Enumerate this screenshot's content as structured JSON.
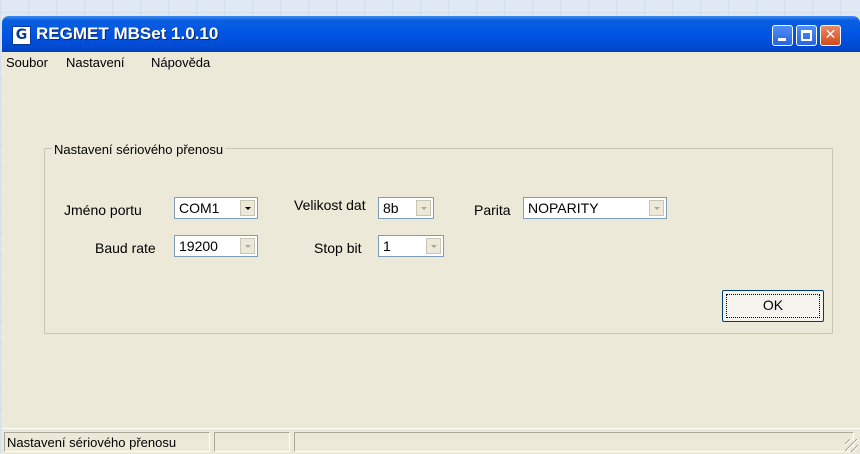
{
  "window": {
    "app_icon": "G",
    "title": "REGMET MBSet 1.0.10"
  },
  "title_buttons": {
    "minimize_icon": "minimize-icon",
    "maximize_icon": "maximize-icon",
    "close_icon": "close-icon",
    "close_glyph": "✕"
  },
  "menu": {
    "items": [
      {
        "label": "Soubor"
      },
      {
        "label": "Nastavení"
      },
      {
        "label": "Nápověda"
      }
    ]
  },
  "serial_settings": {
    "group_title": "Nastavení sériového přenosu",
    "port_name": {
      "label": "Jméno portu",
      "value": "COM1"
    },
    "data_size": {
      "label": "Velikost dat",
      "value": "8b"
    },
    "parity": {
      "label": "Parita",
      "value": "NOPARITY"
    },
    "baud_rate": {
      "label": "Baud rate",
      "value": "19200"
    },
    "stop_bit": {
      "label": "Stop bit",
      "value": "1"
    },
    "ok_label": "OK"
  },
  "statusbar": {
    "panels": [
      "Nastavení sériového přenosu",
      "",
      ""
    ]
  },
  "colors": {
    "titlebar": "#0055e5",
    "window_bg": "#ece9d8",
    "close_button": "#d24a1a"
  }
}
